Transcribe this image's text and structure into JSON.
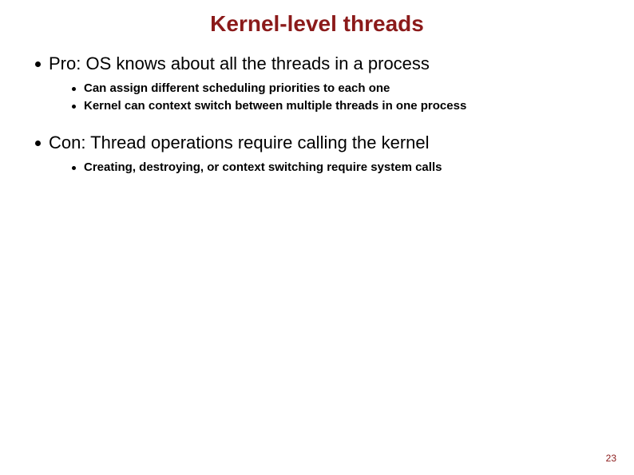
{
  "title": "Kernel-level threads",
  "bullets": [
    {
      "text": "Pro: OS knows about all the threads in a process",
      "sub": [
        "Can assign different scheduling priorities to each one",
        "Kernel can context switch between multiple threads in one process"
      ]
    },
    {
      "text": "Con: Thread operations require calling the kernel",
      "sub": [
        "Creating, destroying, or context switching require system calls"
      ]
    }
  ],
  "page_number": "23"
}
